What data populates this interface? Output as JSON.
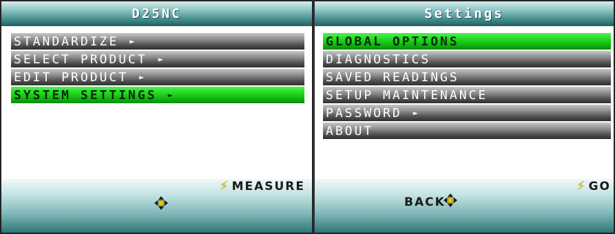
{
  "left_panel": {
    "title": "D25NC",
    "menu": [
      {
        "label": "STANDARDIZE",
        "arrow": "►",
        "selected": false
      },
      {
        "label": "SELECT PRODUCT",
        "arrow": "►",
        "selected": false
      },
      {
        "label": "EDIT PRODUCT",
        "arrow": "►",
        "selected": false
      },
      {
        "label": "SYSTEM SETTINGS",
        "arrow": "►",
        "selected": true
      }
    ],
    "softkey_right": "MEASURE"
  },
  "right_panel": {
    "title": "Settings",
    "menu": [
      {
        "label": "GLOBAL OPTIONS",
        "selected": true
      },
      {
        "label": "DIAGNOSTICS",
        "selected": false
      },
      {
        "label": "SAVED READINGS",
        "selected": false
      },
      {
        "label": "SETUP MAINTENANCE",
        "selected": false
      },
      {
        "label": "PASSWORD",
        "arrow": "►",
        "selected": false
      },
      {
        "label": "ABOUT",
        "selected": false
      }
    ],
    "softkey_left": "BACK",
    "softkey_right": "GO"
  },
  "colors": {
    "selected": "#22d822",
    "title": "#3f8a8a",
    "bolt": "#f0c800"
  },
  "icons": {
    "softkey": "lightning-bolt-icon",
    "navigation": "dpad-icon",
    "submenu": "right-arrow-icon"
  }
}
